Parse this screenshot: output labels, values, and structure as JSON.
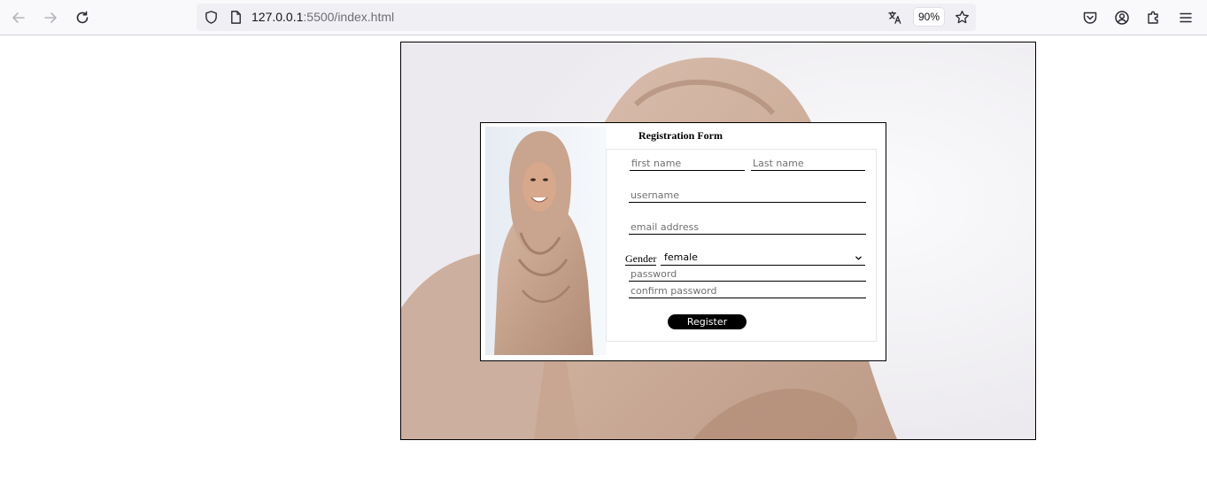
{
  "browser": {
    "url_host": "127.0.0.1",
    "url_path": ":5500/index.html",
    "zoom": "90%"
  },
  "icons": {
    "back": "arrow-left-icon",
    "forward": "arrow-right-icon",
    "reload": "reload-icon",
    "tracking": "shield-icon",
    "page_info": "page-icon",
    "translate": "translate-icon",
    "bookmark": "star-icon",
    "pocket": "pocket-icon",
    "account": "account-icon",
    "extensions": "puzzle-icon",
    "menu": "hamburger-icon"
  },
  "form": {
    "title": "Registration Form",
    "first_name_placeholder": "first name",
    "last_name_placeholder": "Last name",
    "username_placeholder": "username",
    "email_placeholder": "email address",
    "gender_label": "Gender",
    "gender_value": "female",
    "password_placeholder": "password",
    "confirm_password_placeholder": "confirm password",
    "register_label": "Register"
  },
  "colors": {
    "button_bg": "#000000",
    "button_text": "#ffffff",
    "hijab": "#c9a995"
  }
}
